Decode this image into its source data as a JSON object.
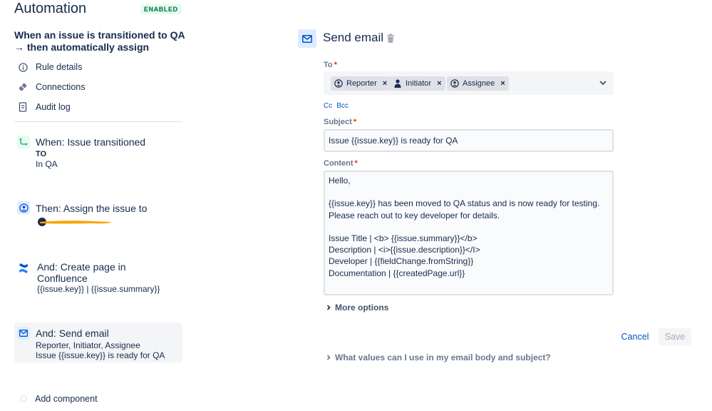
{
  "app": {
    "title": "Automation",
    "status_badge": "ENABLED"
  },
  "rule": {
    "name": "When an issue is transitioned to QA → then automatically assign"
  },
  "nav": [
    {
      "label": "Rule details",
      "icon": "info-icon"
    },
    {
      "label": "Connections",
      "icon": "connections-icon"
    },
    {
      "label": "Audit log",
      "icon": "audit-log-icon"
    }
  ],
  "components": [
    {
      "title": "When: Issue transitioned",
      "lines": [
        "TO",
        "In QA"
      ],
      "icon": "transition-icon",
      "color": "#36b37e"
    },
    {
      "title": "Then: Assign the issue to",
      "lines": [],
      "icon": "assign-icon",
      "color": "#0052cc"
    },
    {
      "title": "And: Create page in Confluence",
      "title_lines": [
        "And: Create page in",
        "Confluence"
      ],
      "lines": [
        "{{issue.key}} | {{issue.summary}}"
      ],
      "icon": "confluence-icon",
      "color": "#0052cc"
    },
    {
      "title": "And: Send email",
      "lines": [
        "Reporter, Initiator, Assignee",
        "Issue {{issue.key}} is ready for QA"
      ],
      "icon": "email-icon",
      "color": "#0052cc"
    }
  ],
  "add_component": {
    "label": "Add component"
  },
  "editor": {
    "title": "Send email",
    "to": {
      "label": "To",
      "required_mark": "*",
      "recipients": [
        "Reporter",
        "Initiator",
        "Assignee"
      ]
    },
    "cc_label": "Cc",
    "bcc_label": "Bcc",
    "subject": {
      "label": "Subject",
      "required_mark": "*",
      "value": "Issue {{issue.key}} is ready for QA"
    },
    "content": {
      "label": "Content",
      "required_mark": "*",
      "lines": [
        "Hello,",
        "",
        "{{issue.key}} has been moved to QA status and is now ready for testing.",
        "Please reach out to key developer for details.",
        "",
        "Issue Title | <b> {{issue.summary}}</b>",
        "Description | <i>{{issue.description}}</I>",
        "Developer | {{fieldChange.fromString}}",
        "Documentation | {{createdPage.url}}"
      ]
    },
    "more_options": "More options",
    "cancel": "Cancel",
    "save": "Save",
    "help": "What values can I use in my email body and subject?"
  },
  "colors": {
    "accent": "#0052cc",
    "redaction": "#f7a500",
    "badge_bg": "#e3fcef",
    "badge_text": "#006644"
  }
}
